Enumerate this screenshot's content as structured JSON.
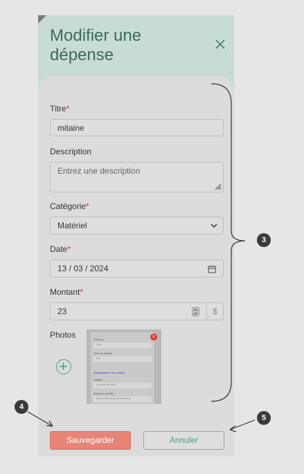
{
  "dialog": {
    "title": "Modifier une dépense",
    "fields": {
      "titre_label": "Titre",
      "titre_value": "mitaine",
      "description_label": "Description",
      "description_placeholder": "Entrez une description",
      "categorie_label": "Catégorie",
      "categorie_value": "Matériel",
      "date_label": "Date",
      "date_value": "13 / 03 / 2024",
      "montant_label": "Montant",
      "montant_value": "23",
      "currency_symbol": "$",
      "photos_label": "Photos",
      "required_mark": "*"
    },
    "thumbnail": {
      "prenom": "Prénom",
      "prenom_value": "Jess",
      "nom": "Nom de famille",
      "nom_value": "Doe",
      "section": "Informations de contact",
      "langue": "Langue",
      "langue_value": "Français canadien",
      "courriel": "Adresse courriel",
      "courriel_value": "jess.doe@exemplepartenaire.ca"
    },
    "buttons": {
      "save": "Sauvegarder",
      "cancel": "Annuler"
    }
  },
  "annotations": {
    "m3": "3",
    "m4": "4",
    "m5": "5"
  },
  "colors": {
    "header": "#c8dcd6",
    "accent": "#4e9a84",
    "save": "#e88476",
    "required": "#d93a3a"
  }
}
